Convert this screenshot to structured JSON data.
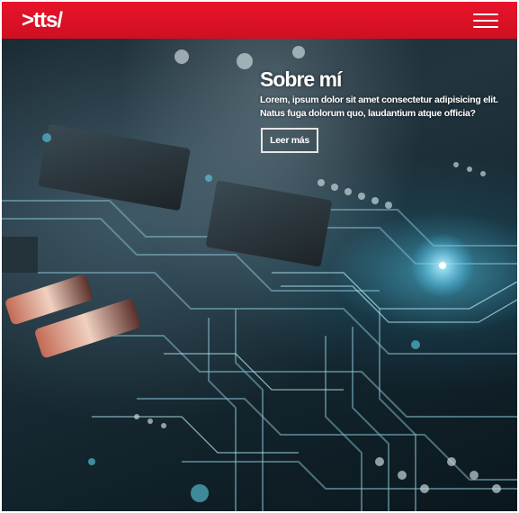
{
  "header": {
    "logo": ">tts/",
    "menu_icon": "hamburger-menu-icon",
    "background_color": "#e8142a"
  },
  "hero": {
    "title": "Sobre mí",
    "text": "Lorem, ipsum dolor sit amet consectetur adipisicing elit. Natus fuga dolorum quo, laudantium atque officia?",
    "button_label": "Leer más",
    "background_image": "circuit-board-image"
  },
  "colors": {
    "accent": "#e8142a",
    "text": "#ffffff"
  }
}
